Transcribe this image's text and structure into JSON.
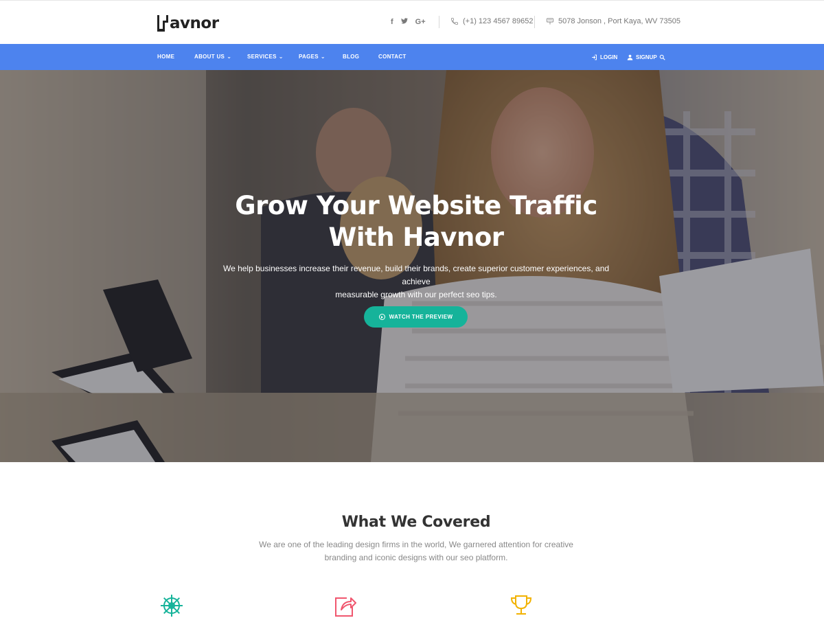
{
  "brand": {
    "logo_text": "avnor"
  },
  "topbar": {
    "socials": [
      "f",
      "🐦",
      "G+"
    ],
    "phone": "(+1) 123 4567 89652",
    "address": "5078 Jonson , Port Kaya, WV 73505"
  },
  "nav": {
    "items": [
      {
        "label": "HOME",
        "dropdown": false
      },
      {
        "label": "ABOUT US",
        "dropdown": true
      },
      {
        "label": "SERVICES",
        "dropdown": true
      },
      {
        "label": "PAGES",
        "dropdown": true
      },
      {
        "label": "BLOG",
        "dropdown": false
      },
      {
        "label": "CONTACT",
        "dropdown": false
      }
    ],
    "login": "LOGIN",
    "signup": "SIGNUP"
  },
  "hero": {
    "title_line1": "Grow Your Website Traffic",
    "title_line2": "With Havnor",
    "subtitle_line1": "We help businesses increase their revenue, build their brands, create superior customer experiences, and achieve",
    "subtitle_line2": "measurable growth with our perfect seo tips.",
    "button_label": "WATCH THE PREVIEW"
  },
  "section": {
    "title": "What We Covered",
    "text_line1": "We are one of the leading design firms in the world, We garnered attention for creative",
    "text_line2": "branding and iconic designs with our seo platform."
  },
  "colors": {
    "nav_bg": "#4d83ee",
    "button_bg": "#16b39a",
    "icon_green": "#16b39a",
    "icon_red": "#f0566e",
    "icon_yellow": "#f2b200"
  },
  "features": [
    {
      "icon": "ship-wheel-icon"
    },
    {
      "icon": "share-box-icon"
    },
    {
      "icon": "trophy-icon"
    }
  ]
}
